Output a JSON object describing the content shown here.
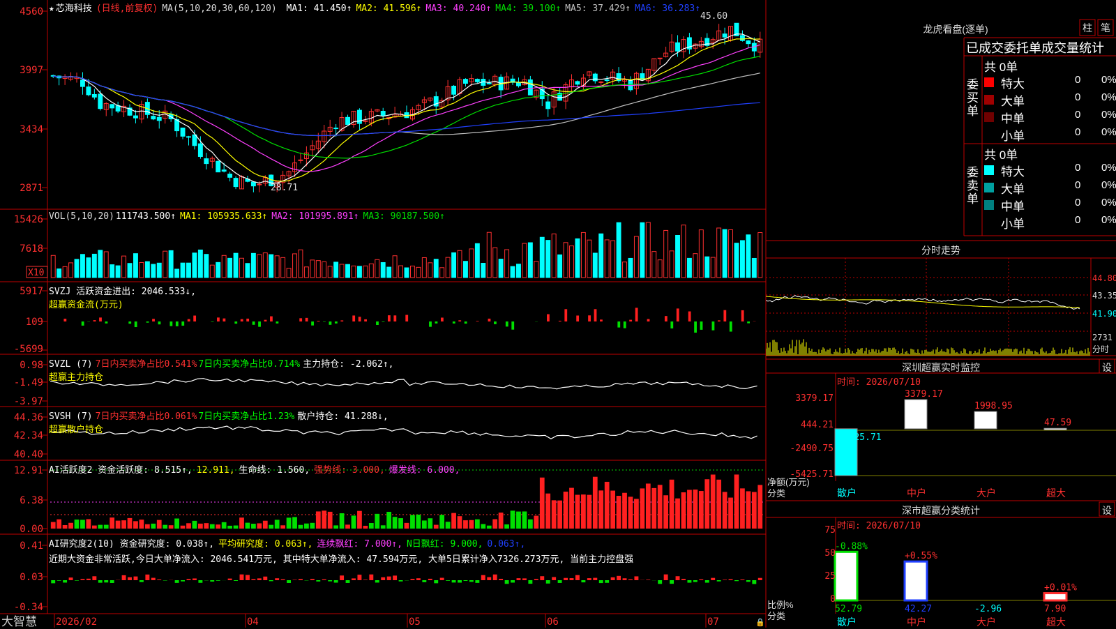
{
  "stock": {
    "star": "★",
    "name": "芯海科技",
    "mode": "(日线,前复权)",
    "ma_label": "MA(5,10,20,30,60,120)",
    "ma": [
      {
        "label": "MA1:",
        "value": "41.450↑",
        "color": "#ffffff"
      },
      {
        "label": "MA2:",
        "value": "41.596↑",
        "color": "#ffff00"
      },
      {
        "label": "MA3:",
        "value": "40.240↑",
        "color": "#ff40ff"
      },
      {
        "label": "MA4:",
        "value": "39.100↑",
        "color": "#00e000"
      },
      {
        "label": "MA5:",
        "value": "37.429↑",
        "color": "#c0c0c0"
      },
      {
        "label": "MA6:",
        "value": "36.283↑",
        "color": "#2040ff"
      }
    ],
    "high_mark": "45.60",
    "low_mark": "28.71"
  },
  "price_axis": [
    "4560",
    "3997",
    "3434",
    "2871"
  ],
  "vol": {
    "label": "VOL(5,10,20)",
    "value": "111743.500↑",
    "ma1": "MA1: 105935.633↑",
    "ma2": "MA2: 101995.891↑",
    "ma3": "MA3: 90187.500↑",
    "axis": [
      "15426",
      "7618"
    ],
    "unit": "X10"
  },
  "svzj": {
    "line1": "SVZJ  活跃资金进出: 2046.533↓,",
    "line2": "超赢资金流(万元)",
    "axis": [
      "5917",
      "109",
      "-5699"
    ]
  },
  "svzl": {
    "name": "SVZL (7)",
    "p1": "7日内买卖净占比0.541%",
    "p2": "7日内买卖净占比0.714%",
    "p3": "主力持仓: -2.062↑,",
    "line2": "超赢主力持仓",
    "axis": [
      "0.98",
      "-1.49",
      "-3.97"
    ]
  },
  "svsh": {
    "name": "SVSH (7)",
    "p1": "7日内买卖净占比0.061%",
    "p2": "7日内买卖净占比1.23%",
    "p3": "散户持仓: 41.288↓,",
    "line2": "超赢散户持仓",
    "axis": [
      "44.36",
      "42.34",
      "40.40"
    ]
  },
  "ai1": {
    "p1": "AI活跃度2 资金活跃度: 8.515↑,",
    "p2": "12.911,",
    "p3": "生命线: 1.560,",
    "p4": "强势线: 3.000,",
    "p5": "爆发线: 6.000,",
    "axis": [
      "12.91",
      "6.38",
      "0.00"
    ]
  },
  "ai2": {
    "p1": "AI研究度2(10) 资金研究度: 0.038↑,",
    "p2": "平均研究度: 0.063↑,",
    "p3": "连续飘红: 7.000↑,",
    "p4": "N日飘红: 9.000,",
    "p5": "0.063↑,",
    "comment": "近期大资金非常活跃,今日大单净流入: 2046.541万元, 其中特大单净流入: 47.594万元, 大单5日累计净入7326.273万元, 当前主力控盘强",
    "axis": [
      "0.41",
      "0.03",
      "-0.34"
    ]
  },
  "time_axis": [
    "2026/02",
    "04",
    "05",
    "06",
    "07"
  ],
  "brand": "大智慧",
  "lhb": {
    "title": "龙虎看盘(逐单)",
    "tab1": "柱",
    "tab2": "笔",
    "subtitle": "已成交委托单成交量统计",
    "buy_label": "委买单",
    "sell_label": "委卖单",
    "buy_total": "共 0单",
    "sell_total": "共 0单",
    "buy_rows": [
      {
        "name": "特大",
        "count": "0",
        "pct": "0%",
        "color": "#ff0000"
      },
      {
        "name": "大单",
        "count": "0",
        "pct": "0%",
        "color": "#a00000"
      },
      {
        "name": "中单",
        "count": "0",
        "pct": "0%",
        "color": "#700000"
      },
      {
        "name": "小单",
        "count": "0",
        "pct": "0%",
        "color": "#000000"
      }
    ],
    "sell_rows": [
      {
        "name": "特大",
        "count": "0",
        "pct": "0%",
        "color": "#00ffff"
      },
      {
        "name": "大单",
        "count": "0",
        "pct": "0%",
        "color": "#00a0a0"
      },
      {
        "name": "中单",
        "count": "0",
        "pct": "0%",
        "color": "#008080"
      },
      {
        "name": "小单",
        "count": "0",
        "pct": "0%",
        "color": "#000000"
      }
    ]
  },
  "intraday": {
    "title": "分时走势",
    "axis": [
      "44.80",
      "43.35",
      "41.90"
    ],
    "vol_axis": "2731",
    "vol_label": "分时"
  },
  "sz_monitor": {
    "title": "深圳超赢实时监控",
    "button": "设",
    "date": "时间: 2026/07/10",
    "axis": [
      "3379.17",
      "444.21",
      "-2490.75",
      "-5425.71"
    ],
    "ylabel1": "净额(万元)",
    "ylabel2": "分类",
    "cats": [
      "散户",
      "中户",
      "大户",
      "超大"
    ]
  },
  "sz_class": {
    "title": "深市超赢分类统计",
    "button": "设",
    "date": "时间: 2026/07/10",
    "axis": [
      "75",
      "50",
      "25",
      "0"
    ],
    "ylabel1": "比例%",
    "ylabel2": "分类",
    "cats": [
      "散户",
      "中户",
      "大户",
      "超大"
    ]
  },
  "chart_data": [
    {
      "type": "candlestick",
      "title": "芯海科技 (日线,前复权)",
      "ylim": [
        28.71,
        45.6
      ],
      "annotations": [
        "45.60",
        "28.71"
      ]
    },
    {
      "type": "bar",
      "title": "深圳超赢实时监控",
      "categories": [
        "散户",
        "中户",
        "大户",
        "超大"
      ],
      "values": [
        -5425.71,
        3379.17,
        1998.95,
        47.59
      ],
      "value_labels": [
        "-5425.71",
        "3379.17",
        "1998.95",
        "47.59"
      ],
      "ylim": [
        -5425.71,
        3379.17
      ],
      "ylabel": "净额(万元)",
      "xlabel": "分类"
    },
    {
      "type": "bar",
      "title": "深市超赢分类统计",
      "categories": [
        "散户",
        "中户",
        "大户",
        "超大"
      ],
      "values": [
        52.79,
        42.27,
        -2.96,
        7.9
      ],
      "value_labels": [
        "52.79",
        "42.27",
        "-2.96",
        "7.90"
      ],
      "change_labels": [
        "-0.88%",
        "+0.55%",
        "",
        "+0.01%"
      ],
      "ylim": [
        0,
        75
      ],
      "ylabel": "比例%",
      "xlabel": "分类"
    }
  ]
}
